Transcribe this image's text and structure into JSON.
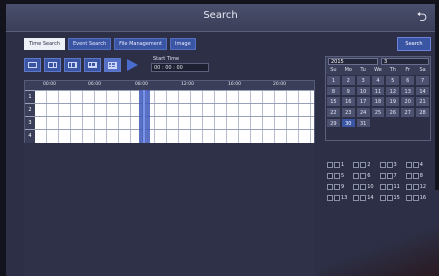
{
  "window": {
    "title": "Search"
  },
  "tabs": [
    {
      "label": "Time Search",
      "active": true
    },
    {
      "label": "Event Search",
      "active": false
    },
    {
      "label": "File Management",
      "active": false
    },
    {
      "label": "Image",
      "active": false
    }
  ],
  "search_button": "Search",
  "start_time": {
    "label": "Start Time",
    "value": "00 : 00 : 00"
  },
  "timeline": {
    "ticks": [
      "00:00",
      "06:00",
      "08:00",
      "12:00",
      "16:00",
      "20:00"
    ],
    "channels": [
      "1",
      "2",
      "3",
      "4"
    ]
  },
  "calendar": {
    "year": "2015",
    "month": "3",
    "weekdays": [
      "Su",
      "Mo",
      "Tu",
      "We",
      "Th",
      "Fr",
      "Sa"
    ],
    "days": [
      "1",
      "2",
      "3",
      "4",
      "5",
      "6",
      "7",
      "8",
      "9",
      "10",
      "11",
      "12",
      "13",
      "14",
      "15",
      "16",
      "17",
      "18",
      "19",
      "20",
      "21",
      "22",
      "23",
      "24",
      "25",
      "26",
      "27",
      "28",
      "29",
      "30",
      "31"
    ],
    "selected_day": "30"
  },
  "channel_checks": [
    "1",
    "2",
    "3",
    "4",
    "5",
    "6",
    "7",
    "8",
    "9",
    "10",
    "11",
    "12",
    "13",
    "14",
    "15",
    "16"
  ],
  "colors": {
    "accent": "#3b55a5",
    "panel": "#2c2f45",
    "selected_day": "#3b55a5"
  }
}
